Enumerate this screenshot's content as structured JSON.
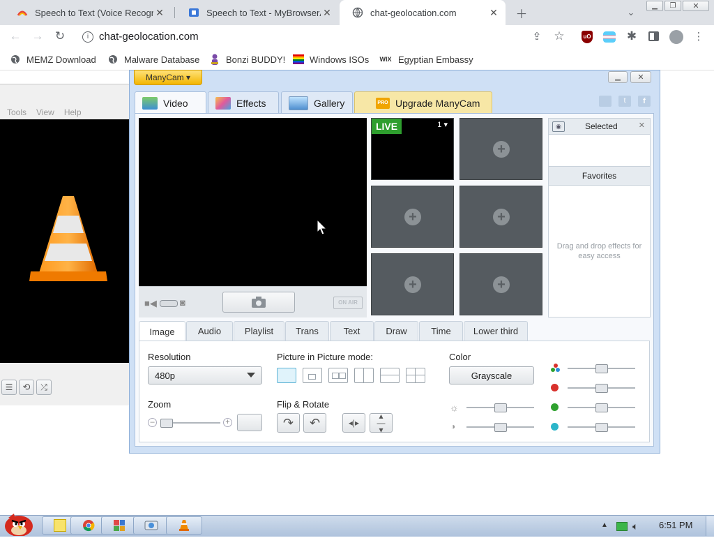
{
  "browser": {
    "tabs": [
      {
        "title": "Speech to Text (Voice Recogni",
        "favicon": "speech-favicon"
      },
      {
        "title": "Speech to Text - MyBrowserAd",
        "favicon": "mybrowser-favicon"
      },
      {
        "title": "chat-geolocation.com",
        "favicon": "globe-favicon"
      }
    ],
    "url": "chat-geolocation.com",
    "bookmarks": [
      {
        "label": "MEMZ Download",
        "icon": "globe-icon"
      },
      {
        "label": "Malware Database",
        "icon": "globe-icon"
      },
      {
        "label": "Bonzi BUDDY!",
        "icon": "bonzi-icon"
      },
      {
        "label": "Windows ISOs",
        "icon": "windows-flag-icon"
      },
      {
        "label": "Egyptian Embassy",
        "icon": "wix-icon"
      }
    ],
    "wix_text": "WIX"
  },
  "vlc": {
    "menu": [
      "Tools",
      "View",
      "Help"
    ]
  },
  "manycam": {
    "menu_label": "ManyCam ▾",
    "tabs": [
      {
        "label": "Video"
      },
      {
        "label": "Effects"
      },
      {
        "label": "Gallery"
      },
      {
        "label": "Upgrade ManyCam"
      }
    ],
    "pro_badge": "PRO",
    "live_badge": "LIVE",
    "live_channel": "1",
    "on_air": "ON AIR",
    "selected_header": "Selected",
    "favorites_header": "Favorites",
    "favorites_hint": "Drag and drop effects for easy access",
    "control_tabs": [
      "Image",
      "Audio",
      "Playlist",
      "Trans",
      "Text",
      "Draw",
      "Time",
      "Lower third"
    ],
    "resolution_label": "Resolution",
    "resolution_value": "480p",
    "pip_label": "Picture in Picture mode:",
    "color_label": "Color",
    "grayscale_label": "Grayscale",
    "zoom_label": "Zoom",
    "flip_label": "Flip & Rotate",
    "colors": {
      "red": "#d8312c",
      "green": "#2fa12f",
      "cyan": "#2bb5c9"
    },
    "sliders": {
      "zoom": 0.0,
      "brightness": 0.5,
      "contrast": 0.5,
      "saturation": 0.5,
      "red": 0.5,
      "green": 0.5,
      "blue": 0.5
    }
  },
  "taskbar": {
    "clock": "6:51 PM",
    "apps": [
      "sticky-notes",
      "chrome",
      "control-panel",
      "manycam",
      "vlc"
    ]
  }
}
